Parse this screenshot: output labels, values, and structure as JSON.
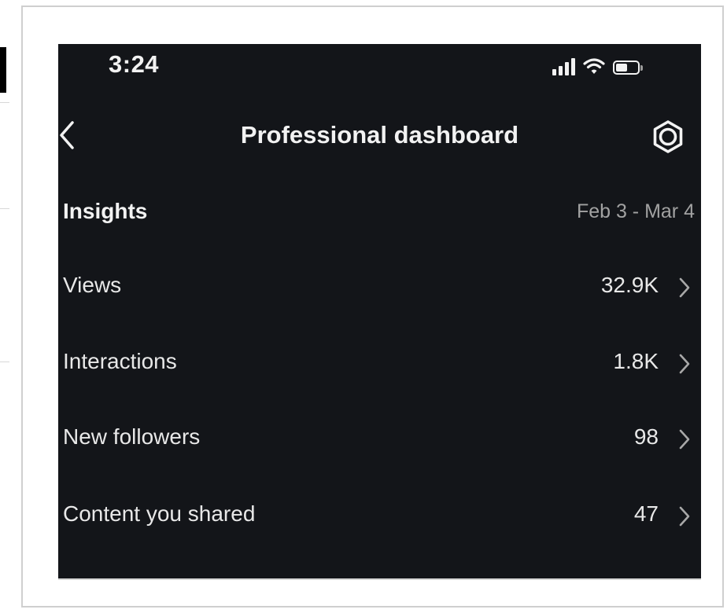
{
  "status_bar": {
    "time": "3:24",
    "battery_level": 0.55,
    "icons": [
      "signal-icon",
      "wifi-icon",
      "battery-icon"
    ]
  },
  "header": {
    "title": "Professional dashboard",
    "back_icon": "chevron-left-icon",
    "settings_icon": "settings-gear-icon"
  },
  "insights": {
    "title": "Insights",
    "date_range": "Feb 3 - Mar 4",
    "metrics": [
      {
        "label": "Views",
        "value": "32.9K"
      },
      {
        "label": "Interactions",
        "value": "1.8K"
      },
      {
        "label": "New followers",
        "value": "98"
      },
      {
        "label": "Content you shared",
        "value": "47"
      }
    ]
  },
  "colors": {
    "background": "#131519",
    "text": "#f2f2f2",
    "muted_text": "#a2a2a2"
  }
}
